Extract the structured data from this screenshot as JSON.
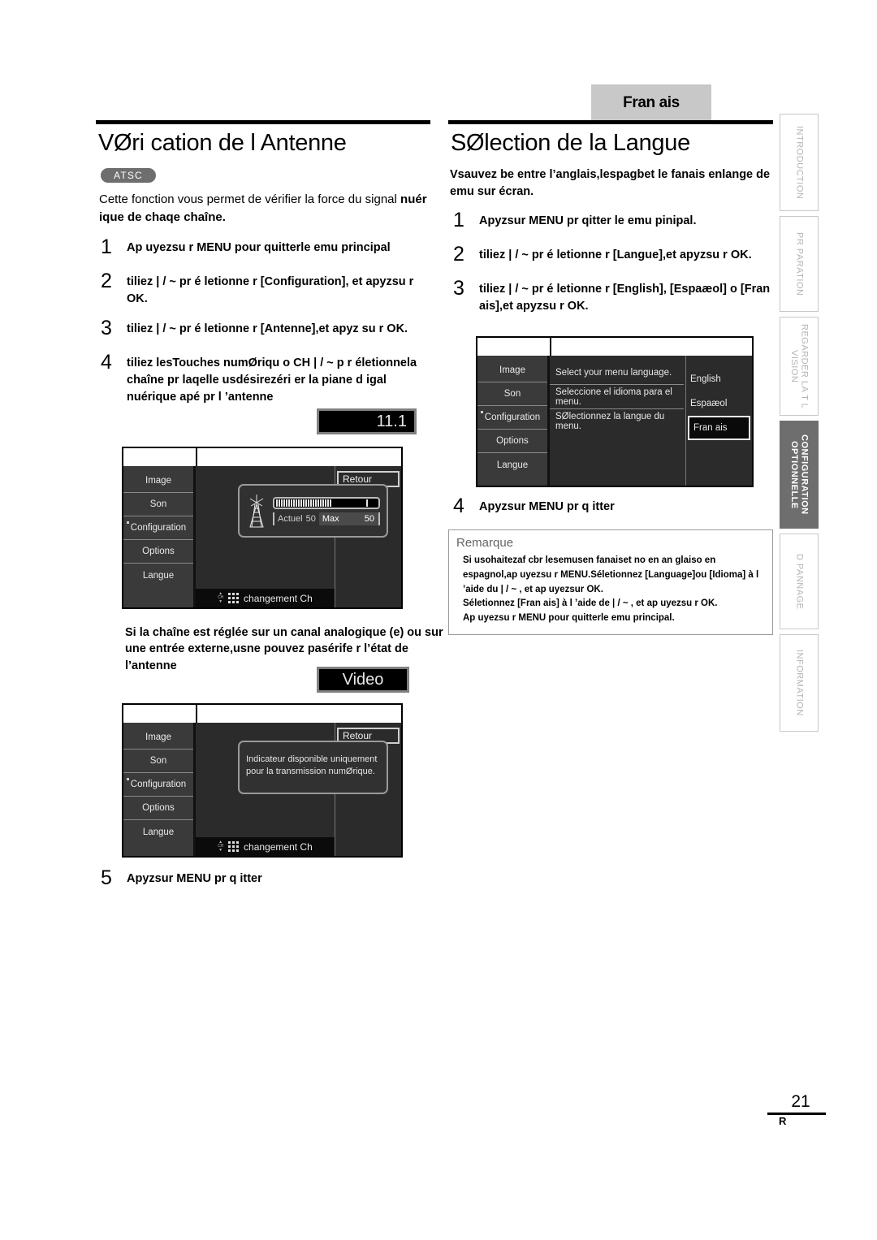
{
  "language_tab": "Fran ais",
  "left": {
    "title": "VØri cation de l Antenne",
    "badge": "ATSC",
    "intro_regular": "Cette fonction vous permet de vérifier la force du signal ",
    "intro_bold": "nuér ique  de chaqe chaîne.",
    "steps": [
      {
        "num": "1",
        "text": "Ap uyezsu r MENU pour quitterle  emu   principal"
      },
      {
        "num": "2",
        "text": "tiliez    | / ~  pr é    letionne r [Configuration], et apyzsu       r OK."
      },
      {
        "num": "3",
        "text": "tiliez    | / ~  pr é    letionne r [Antenne],et apyz  su r OK."
      },
      {
        "num": "4",
        "text": "tiliez   lesTouches numØriqu o  CH   | / ~ p    r életionnela chaîne pr laqelle  usdésirezéri                er la piane d igal nuérique  apé pr l             ’antenne"
      }
    ],
    "channel_badge": "11.1",
    "video_badge": "Video",
    "note_bold": "Si la chaîne est réglée sur un canal analogique (e) ou sur une entrée externe,usne   pouvez   pasérife r l’état de l’antenne",
    "step5": {
      "num": "5",
      "text": "Apyzsur      MENU  pr q    itter"
    }
  },
  "right": {
    "title": "SØlection de la Langue",
    "lead": "Vsauvez be entre l’anglais,lespagbet le fanais enlange de emu sur écran.",
    "steps": [
      {
        "num": "1",
        "text": "Apyzsur          MENU pr qitter le emu pinipal."
      },
      {
        "num": "2",
        "text": "tiliez    | / ~  pr é    letionne r [Langue],et apyzsu       r OK."
      },
      {
        "num": "3",
        "text": "tiliez    | / ~  pr é    letionne r [English], [Espaæol] o [Fran ais],et apyzsu       r OK."
      },
      {
        "num": "4",
        "text": "Apyzsur      MENU  pr q    itter"
      }
    ],
    "remarque": {
      "title": "Remarque",
      "lines": [
        "Si usohaitezaf          cbr lesemusen fanaiset no en an       glaiso en espagnol,ap uyezsu r MENU.Séletionnez    [Language]ou  [Idioma] à l ’aide du  | / ~ , et ap uyezsur  OK.",
        "Séletionnez [Fran ais] à l ’aide de   | / ~ , et ap uyezsu r OK.",
        "Ap uyezsu r MENU pour  quitterle emu  principal."
      ]
    }
  },
  "osd": {
    "menu_items": [
      "Image",
      "Son",
      "Configuration",
      "Options",
      "Langue"
    ],
    "selected_menu": "Configuration",
    "retour": "Retour",
    "bottom_hint": "changement Ch",
    "ch_label": "CH",
    "signal": {
      "current_label": "Actuel",
      "current_value": "50",
      "max_label": "Max",
      "max_value": "50"
    },
    "message": "Indicateur disponible uniquement pour la transmission numØrique.",
    "language_prompts": [
      "Select your menu language.",
      "Seleccione el idioma para el menu.",
      "SØlectionnez la langue du menu."
    ],
    "language_options": [
      "English",
      "Espaæol",
      "Fran ais"
    ],
    "language_selected": "Fran ais"
  },
  "side_tabs": [
    {
      "label": "INTRODUCTION",
      "active": false
    },
    {
      "label": "PR PARATION",
      "active": false
    },
    {
      "label": "REGARDER LA T L VISION",
      "active": false
    },
    {
      "label": "CONFIGURATION OPTIONNELLE",
      "active": true
    },
    {
      "label": "D PANNAGE",
      "active": false
    },
    {
      "label": "INFORMATION",
      "active": false
    }
  ],
  "footer": {
    "page": "21",
    "mark": "R"
  }
}
